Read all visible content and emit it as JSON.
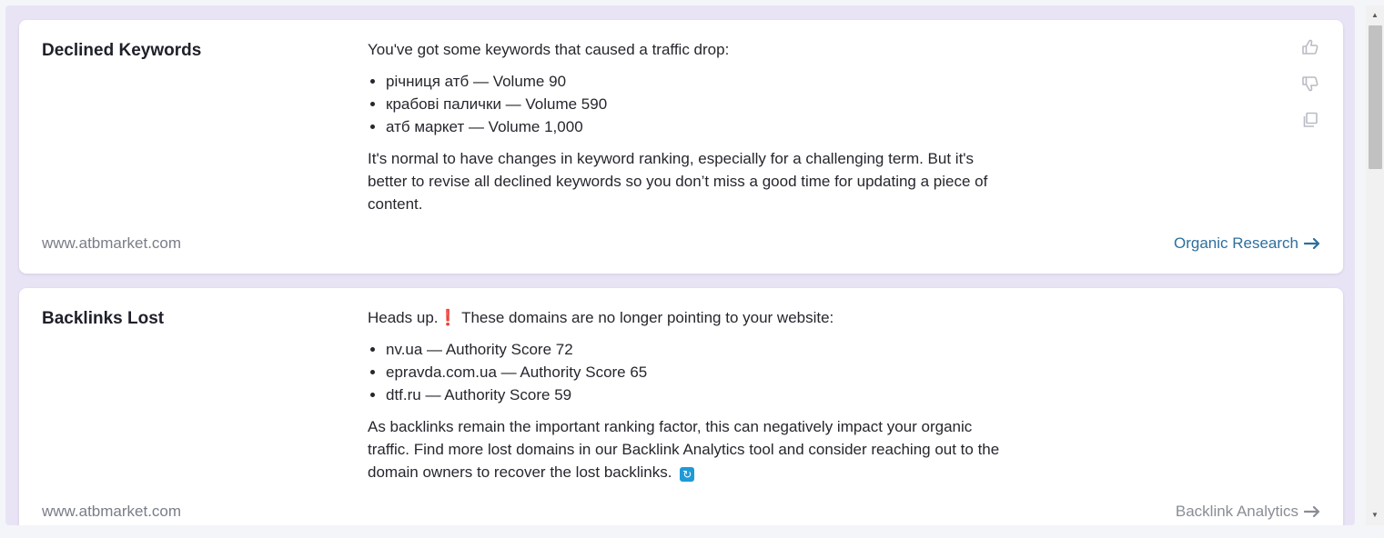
{
  "cards": [
    {
      "title": "Declined Keywords",
      "intro": "You've got some keywords that caused a traffic drop:",
      "items": [
        "річниця атб — Volume 90",
        "крабові палички — Volume 590",
        "атб маркет — Volume 1,000"
      ],
      "outro": "It's normal to have changes in keyword ranking, especially for a challenging term. But it's better to revise all declined keywords so you don’t miss a good time for updating a piece of content.",
      "domain": "www.atbmarket.com",
      "link_label": "Organic Research",
      "actions": [
        "thumbs-up-icon",
        "thumbs-down-icon",
        "copy-icon"
      ]
    },
    {
      "title": "Backlinks Lost",
      "intro_prefix": "Heads up.",
      "intro_emoji": "❗",
      "intro_suffix": " These domains are no longer pointing to your website:",
      "items": [
        "nv.ua — Authority Score 72",
        "epravda.com.ua — Authority Score 65",
        "dtf.ru — Authority Score 59"
      ],
      "outro": "As backlinks remain the important ranking factor, this can negatively impact your organic traffic. Find more lost domains in our Backlink Analytics tool and consider reaching out to the domain owners to recover the lost backlinks.",
      "outro_emoji": "🔄",
      "domain": "www.atbmarket.com",
      "link_label": "Backlink Analytics"
    }
  ],
  "colors": {
    "link": "#2d6f9e",
    "link_muted": "#8a8d96",
    "page_bg": "#e9e4f5",
    "card_bg": "#ffffff"
  }
}
